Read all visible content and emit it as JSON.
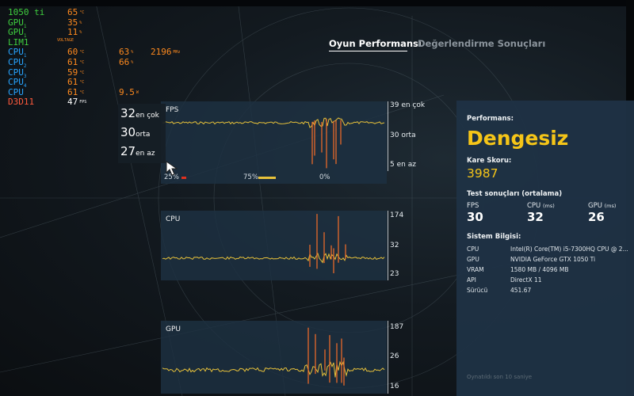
{
  "osd": {
    "rows": [
      {
        "label": "1050 ti",
        "label_color": "green",
        "v1": "65",
        "u1": "°C",
        "v1_color": "orange"
      },
      {
        "label": "GPU1",
        "label_color": "green",
        "v1": "35",
        "u1": "%",
        "v1_color": "orange"
      },
      {
        "label": "GPU1",
        "label_color": "green",
        "v1": "11",
        "u1": "%",
        "v1_color": "orange"
      },
      {
        "label": "LIM1",
        "label_color": "green",
        "v1": "",
        "u1": "",
        "v1_color": "orange"
      },
      {
        "label": "CPU1",
        "label_color": "blue",
        "v1": "60",
        "u1": "°C",
        "v1_color": "orange",
        "v2": "63",
        "u2": "%",
        "v3": "2196",
        "u3": "MHz"
      },
      {
        "label": "CPU2",
        "label_color": "blue",
        "v1": "61",
        "u1": "°C",
        "v1_color": "orange",
        "v2": "66",
        "u2": "%"
      },
      {
        "label": "CPU3",
        "label_color": "blue",
        "v1": "59",
        "u1": "°C",
        "v1_color": "orange"
      },
      {
        "label": "CPU4",
        "label_color": "blue",
        "v1": "61",
        "u1": "°C",
        "v1_color": "orange"
      },
      {
        "label": "CPU",
        "label_color": "blue",
        "v1": "61",
        "u1": "°C",
        "v1_color": "orange",
        "v2": "9.5",
        "u2": "W"
      },
      {
        "label": "D3D11",
        "label_color": "red",
        "v1": "47",
        "u1": "FPS",
        "v1_color": "white"
      }
    ],
    "voltage_label": "VOLTAGE"
  },
  "tabs": {
    "active": "Oyun Performansı",
    "inactive": "Değerlendirme Sonuçları"
  },
  "fps_chart": {
    "label": "FPS",
    "axis_top": "39",
    "axis_top_suffix": "en çok",
    "axis_mid": "30",
    "axis_mid_suffix": "orta",
    "axis_bottom": "5",
    "axis_bottom_suffix": "en az",
    "stats": {
      "max_num": "32",
      "max_lbl": "en çok",
      "avg_num": "30",
      "avg_lbl": "orta",
      "min_num": "27",
      "min_lbl": "en az"
    },
    "pct_25": "25%",
    "pct_75": "75%",
    "pct_0": "0%",
    "color_25": "#e0301e",
    "color_75": "#e8c23a"
  },
  "cpu_chart": {
    "label": "CPU",
    "axis_top": "174",
    "axis_mid": "32",
    "axis_bottom": "23"
  },
  "gpu_chart": {
    "label": "GPU",
    "axis_top": "187",
    "axis_mid": "26",
    "axis_bottom": "16"
  },
  "results": {
    "performance_label": "Performans:",
    "performance_value": "Dengesiz",
    "score_label": "Kare Skoru:",
    "score_value": "3987",
    "test_results_label": "Test sonuçları (ortalama)",
    "fps_label": "FPS",
    "fps_value": "30",
    "cpu_label": "CPU",
    "cpu_unit": "(ms)",
    "cpu_value": "32",
    "gpu_label": "GPU",
    "gpu_unit": "(ms)",
    "gpu_value": "26",
    "system_info_label": "Sistem Bilgisi:",
    "info": [
      {
        "label": "CPU",
        "value": "Intel(R) Core(TM) i5-7300HQ CPU @ 2..."
      },
      {
        "label": "GPU",
        "value": "NVIDIA GeForce GTX 1050 Ti"
      },
      {
        "label": "VRAM",
        "value": "1580 MB / 4096 MB"
      },
      {
        "label": "API",
        "value": "DirectX 11"
      },
      {
        "label": "Sürücü",
        "value": "451.67"
      }
    ],
    "footer": "Oynatıldı son 10 saniye"
  },
  "colors": {
    "accent_yellow": "#f5c518",
    "line_yellow": "#e8c23a",
    "spike_orange": "#e8692a",
    "panel_blue": "#1f3244"
  }
}
